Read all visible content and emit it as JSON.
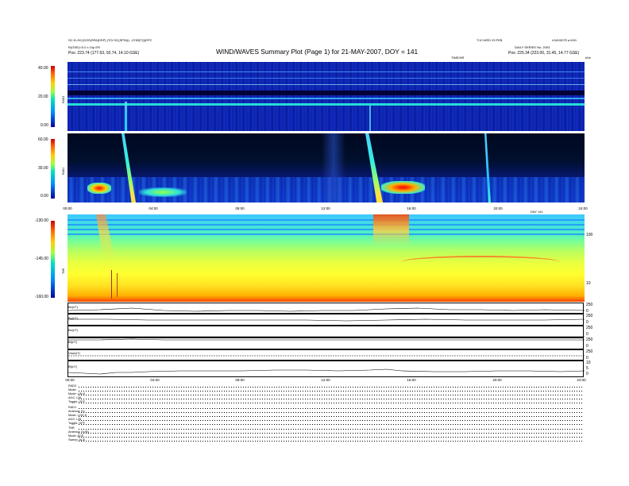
{
  "header": {
    "top_left_1": "SC:D=SC(GOS)SPA(DSP) (TOI SC(SPIN)): -0783(TQ)EPC",
    "top_left_2": "R(GSE)=S.0 x 10µ ER",
    "top_left_3": "Pos:   223.74 (177.63, 92.74, 14.10 GSE)",
    "title": "WIND/WAVES Summary Plot (Page 1) for 21-MAY-2007, DOY = 141",
    "top_right_1": "T:10 WED 29 FEB",
    "top_right_2": "LD#V0075 a 6/01",
    "top_right_3": "DAILY  SERIES No. 2003",
    "top_right_4": "Pos:   225.34 (223.00, 31.45, 14.77 GSE)",
    "top_right_5": "TIME/HR",
    "top_right_6": "kHz"
  },
  "panels": {
    "rad2": {
      "label": "RAD2",
      "ticks": [
        "40.00",
        "20.00",
        "0.00"
      ]
    },
    "rad1": {
      "label": "RAD1",
      "ticks": [
        "60.00",
        "30.00",
        "0.00"
      ]
    },
    "tnr": {
      "label": "TNR",
      "ticks": [
        "-130.00",
        "-145.00",
        "-160.00"
      ],
      "right_ticks": [
        "100",
        "10"
      ]
    },
    "time_axis_upper": [
      "00:00",
      "04:00",
      "08:00",
      "12:00",
      "16:00",
      "20:00",
      "24:00"
    ],
    "time_axis_lower": [
      "00:00",
      "04:00",
      "08:00",
      "12:00",
      "16:00",
      "20:00",
      "24:00"
    ],
    "time_label": "DAY 141"
  },
  "line_plots": [
    {
      "label": "Bx(nT)",
      "ticks": [
        "250",
        "0"
      ]
    },
    {
      "label": "By(nT)",
      "ticks": [
        "250",
        "0"
      ]
    },
    {
      "label": "Bz(nT)",
      "ticks": [
        "250",
        "0"
      ]
    },
    {
      "label": "Bt(nT)",
      "ticks": [
        "250",
        "0"
      ]
    },
    {
      "label": "Vsw(nT)",
      "ticks": [
        "250",
        "0"
      ]
    },
    {
      "label": "Bt(nT)",
      "ticks": [
        "10",
        "5",
        "0"
      ]
    }
  ],
  "info": [
    "RAD2",
    "Mode:      ",
    "Mode:    LIN 8",
    "AGC:    LIN",
    "Toggle:    OFF",
    "RAD1",
    "Antenna:     Ex",
    "Mode:    LOG θ",
    "AGC:    LIN",
    "Toggle:    OFF",
    "TNR",
    "Antenna:   Ex/Ey",
    "Mode:    ACE",
    "Sweep:    ACE"
  ],
  "colors": {
    "colorbar_top": "#cc0000",
    "colorbar_mid": "#00e0c0",
    "colorbar_bottom": "#0000a0",
    "spectrogram_background": "#0a1a9a"
  }
}
